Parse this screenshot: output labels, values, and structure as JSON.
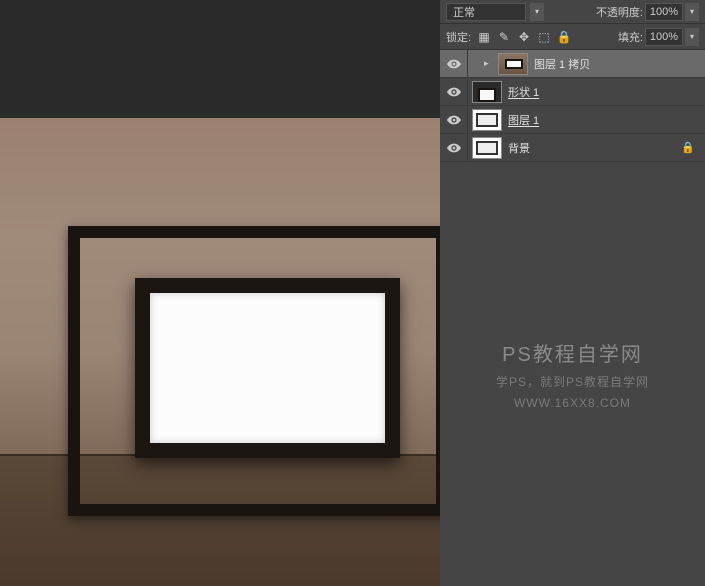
{
  "panel": {
    "blend_mode": "正常",
    "opacity_label": "不透明度:",
    "opacity_value": "100%",
    "lock_label": "锁定:",
    "fill_label": "填充:",
    "fill_value": "100%"
  },
  "layers": [
    {
      "name": "图层 1 拷贝",
      "visible": true,
      "selected": true,
      "locked": false,
      "indent": true
    },
    {
      "name": "形状 1",
      "visible": true,
      "selected": false,
      "locked": false,
      "indent": false
    },
    {
      "name": "图层 1",
      "visible": true,
      "selected": false,
      "locked": false,
      "indent": false
    },
    {
      "name": "背景",
      "visible": true,
      "selected": false,
      "locked": true,
      "indent": false
    }
  ],
  "watermark": {
    "title": "PS教程自学网",
    "subtitle": "学PS，就到PS教程自学网",
    "url": "WWW.16XX8.COM"
  }
}
